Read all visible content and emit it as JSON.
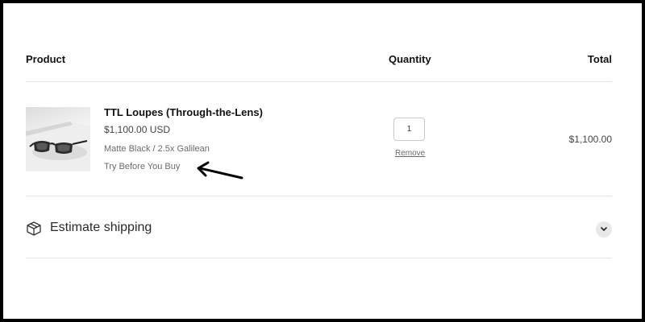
{
  "table_header": {
    "product": "Product",
    "quantity": "Quantity",
    "total": "Total"
  },
  "cart": {
    "items": [
      {
        "title": "TTL Loupes (Through-the-Lens)",
        "price": "$1,100.00 USD",
        "variant": "Matte Black / 2.5x Galilean",
        "option": "Try Before You Buy",
        "quantity": "1",
        "remove_label": "Remove",
        "line_total": "$1,100.00",
        "image_icon": "glasses-product-image"
      }
    ]
  },
  "shipping": {
    "label": "Estimate shipping",
    "icon": "box-icon",
    "toggle_icon": "chevron-down-icon"
  },
  "annotation": {
    "icon": "arrow-pointer-icon",
    "color": "#000000"
  },
  "colors": {
    "frame_border": "#000000",
    "divider": "#e6e6e6",
    "text_primary": "#121212",
    "text_secondary": "#6b6b6b"
  }
}
